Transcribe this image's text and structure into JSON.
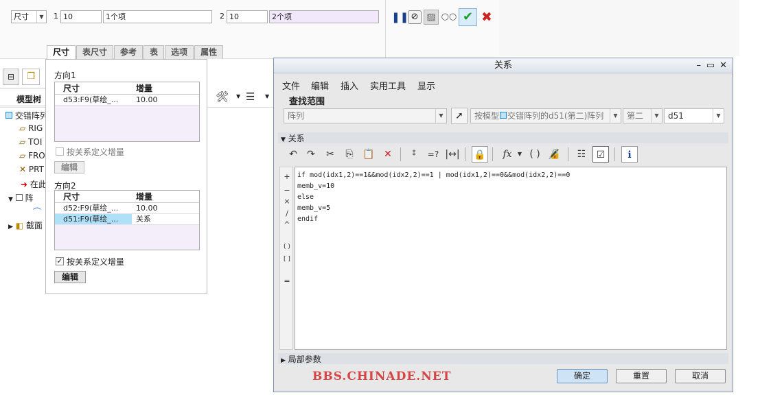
{
  "dashboard": {
    "type_select": "尺寸",
    "dir1_label": "1",
    "dir1_value": "10",
    "dir1_items": "1个项",
    "dir2_label": "2",
    "dir2_value": "10",
    "dir2_items": "2个项",
    "tabs": [
      "尺寸",
      "表尺寸",
      "参考",
      "表",
      "选项",
      "属性"
    ]
  },
  "panel": {
    "dir1_title": "方向1",
    "dir2_title": "方向2",
    "col_dim": "尺寸",
    "col_inc": "增量",
    "dir1_rows": [
      {
        "dim": "d53:F9(草绘_...",
        "inc": "10.00"
      }
    ],
    "dir2_rows": [
      {
        "dim": "d52:F9(草绘_...",
        "inc": "10.00"
      },
      {
        "dim": "d51:F9(草绘_...",
        "inc": "关系"
      }
    ],
    "relation_check_label": "按关系定义增量",
    "edit_label": "编辑"
  },
  "tree": {
    "header": "模型树",
    "items": [
      "交错阵列",
      "RIG",
      "TOI",
      "FRO",
      "PRT",
      "在此",
      "阵",
      "截面"
    ]
  },
  "dialog": {
    "title": "关系",
    "menu": [
      "文件",
      "编辑",
      "插入",
      "实用工具",
      "显示"
    ],
    "lookup_title": "查找范围",
    "lookup_type": "阵列",
    "lookup_model_label": "按模型",
    "lookup_model_value": "交错阵列的d51(第二)阵列",
    "lookup_dir": "第二",
    "lookup_dim": "d51",
    "relations_title": "关系",
    "code_lines": [
      "if mod(idx1,2)==1&&mod(idx2,2)==1 | mod(idx1,2)==0&&mod(idx2,2)==0",
      "memb_v=10",
      "else",
      "memb_v=5",
      "endif"
    ],
    "ops": [
      "+",
      "−",
      "×",
      "/",
      "^",
      "( )",
      "[ ]",
      "="
    ],
    "local_params": "局部参数",
    "ok": "确定",
    "reset": "重置",
    "cancel": "取消"
  },
  "watermark": "BBS.CHINADE.NET"
}
